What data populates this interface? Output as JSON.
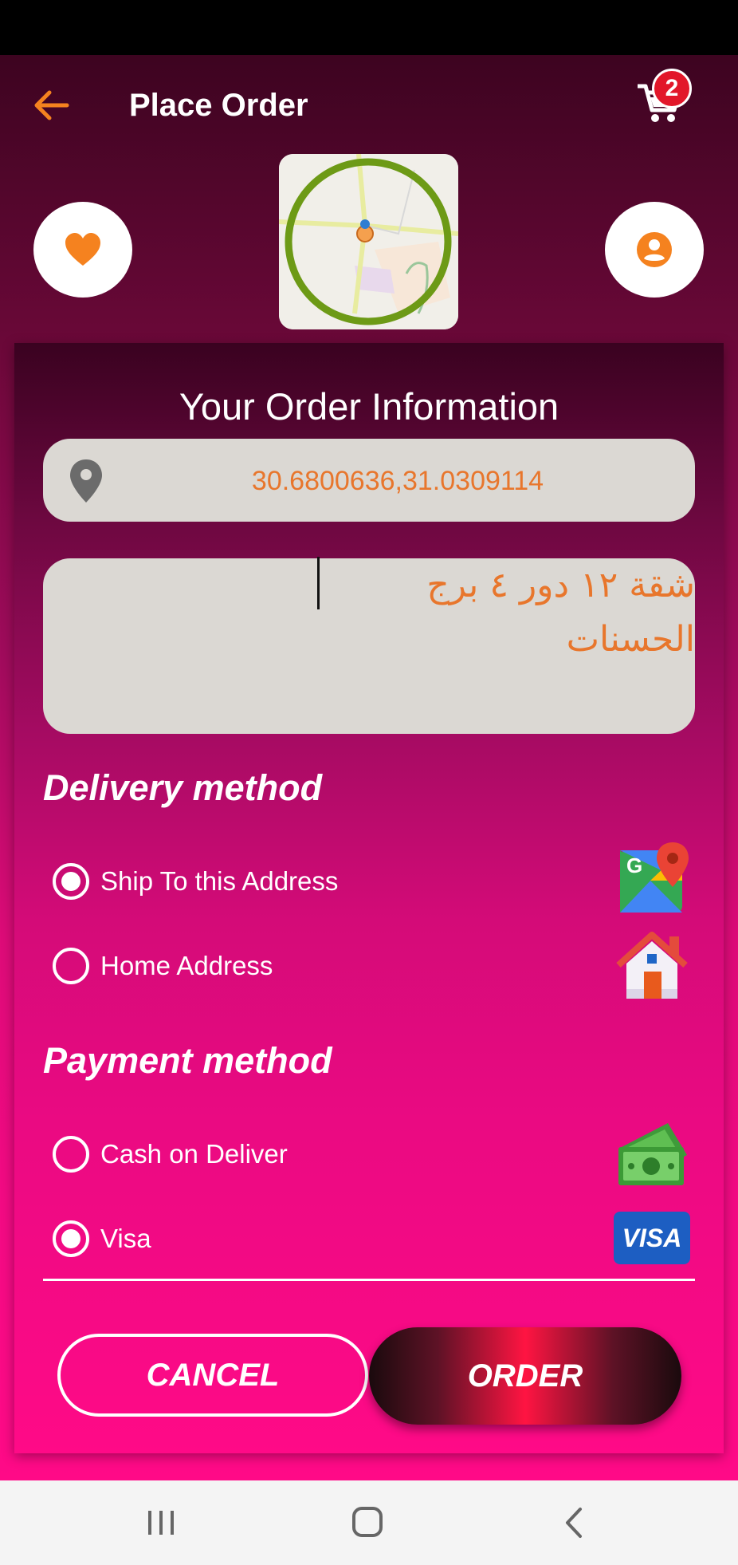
{
  "appbar": {
    "title": "Place Order",
    "cart_count": "2"
  },
  "order_info": {
    "heading": "Your Order Information",
    "coordinates": "30.6800636,31.0309114",
    "address": "شقة ١٢ دور ٤ برج الحسنات"
  },
  "delivery": {
    "title": "Delivery method",
    "options": [
      {
        "label": "Ship To this Address",
        "selected": true,
        "icon": "google-maps-icon"
      },
      {
        "label": "Home Address",
        "selected": false,
        "icon": "house-icon"
      }
    ]
  },
  "payment": {
    "title": "Payment method",
    "options": [
      {
        "label": "Cash on Deliver",
        "selected": false,
        "icon": "cash-icon"
      },
      {
        "label": "Visa",
        "selected": true,
        "icon": "visa-icon",
        "icon_text": "VISA"
      }
    ]
  },
  "actions": {
    "cancel": "CANCEL",
    "order": "ORDER"
  },
  "colors": {
    "accent_orange": "#f5821f",
    "field_bg": "#dbd8d3",
    "field_text": "#e8762c",
    "pink": "#ff0a87"
  }
}
